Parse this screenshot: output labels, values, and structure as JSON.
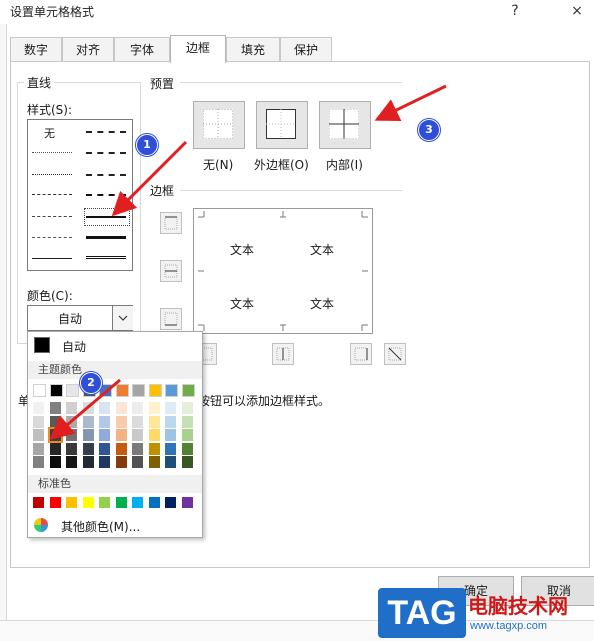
{
  "dialog": {
    "title": "设置单元格格式",
    "help": "?",
    "close": "×"
  },
  "tabs": [
    {
      "label": "数字"
    },
    {
      "label": "对齐"
    },
    {
      "label": "字体"
    },
    {
      "label": "边框"
    },
    {
      "label": "填充"
    },
    {
      "label": "保护"
    }
  ],
  "line_group": {
    "title": "直线",
    "style_label": "样式(S):",
    "none_label": "无",
    "color_label": "颜色(C):",
    "color_value": "自动"
  },
  "presets": {
    "title": "预置",
    "items": [
      {
        "label": "无(N)"
      },
      {
        "label": "外边框(O)"
      },
      {
        "label": "内部(I)"
      }
    ]
  },
  "border": {
    "title": "边框",
    "preview_text": [
      "文本",
      "文本",
      "文本",
      "文本"
    ]
  },
  "hint_text": "单击预置选项、预览草图及上面的按钮可以添加边框样式。",
  "dropdown": {
    "auto_label": "自动",
    "theme_label": "主题颜色",
    "standard_label": "标准色",
    "more_label": "其他颜色(M)...",
    "theme_top": [
      "#ffffff",
      "#000000",
      "#e7e6e6",
      "#44546a",
      "#4472c4",
      "#ed7d31",
      "#a5a5a5",
      "#ffc000",
      "#5b9bd5",
      "#70ad47"
    ],
    "theme_shades": [
      [
        "#f2f2f2",
        "#d9d9d9",
        "#bfbfbf",
        "#a6a6a6",
        "#808080"
      ],
      [
        "#808080",
        "#595959",
        "#404040",
        "#262626",
        "#0d0d0d"
      ],
      [
        "#d0cece",
        "#aeaaaa",
        "#757171",
        "#3a3838",
        "#171616"
      ],
      [
        "#d6dce4",
        "#adb9ca",
        "#8497b0",
        "#333f4f",
        "#222a35"
      ],
      [
        "#dae3f3",
        "#b4c7e7",
        "#8faadc",
        "#2f5597",
        "#1f3864"
      ],
      [
        "#fbe5d6",
        "#f8cbad",
        "#f4b183",
        "#c55a11",
        "#843c0c"
      ],
      [
        "#ededed",
        "#dbdbdb",
        "#c9c9c9",
        "#7b7b7b",
        "#525252"
      ],
      [
        "#fff2cc",
        "#ffe699",
        "#ffd966",
        "#bf9000",
        "#7f6000"
      ],
      [
        "#deebf7",
        "#bdd7ee",
        "#9dc3e6",
        "#2e75b6",
        "#1f4e79"
      ],
      [
        "#e2f0d9",
        "#c5e0b4",
        "#a9d18e",
        "#548235",
        "#385723"
      ]
    ],
    "standard": [
      "#c00000",
      "#ff0000",
      "#ffc000",
      "#ffff00",
      "#92d050",
      "#00b050",
      "#00b0f0",
      "#0070c0",
      "#002060",
      "#7030a0"
    ]
  },
  "annotations": [
    {
      "label": "1"
    },
    {
      "label": "2"
    },
    {
      "label": "3"
    }
  ],
  "arrow_color": "#e02020",
  "buttons": {
    "ok": "确定",
    "cancel": "取消"
  },
  "watermark": {
    "logo": "TAG",
    "site_name": "电脑技术网",
    "url": "www.tagxp.com"
  }
}
